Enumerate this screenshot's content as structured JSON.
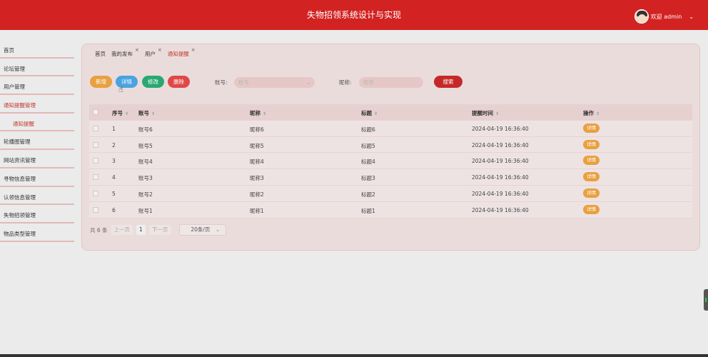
{
  "header": {
    "title": "失物招领系统设计与实现",
    "user": "欢迎 admin",
    "dropdown_icon": "chevron-down-icon"
  },
  "sidebar": {
    "items": [
      {
        "label": "首页"
      },
      {
        "label": "论坛管理"
      },
      {
        "label": "用户管理"
      },
      {
        "label": "通知提醒管理"
      },
      {
        "label": "通知提醒"
      },
      {
        "label": "轮播图管理"
      },
      {
        "label": "网站资讯管理"
      },
      {
        "label": "寻物信息管理"
      },
      {
        "label": "认领信息管理"
      },
      {
        "label": "失物招领管理"
      },
      {
        "label": "物品类型管理"
      }
    ]
  },
  "tabs": [
    {
      "label": "首页",
      "close": ""
    },
    {
      "label": "我的发布",
      "close": "×"
    },
    {
      "label": "用户",
      "close": "×"
    },
    {
      "label": "通知提醒",
      "close": "×"
    }
  ],
  "toolbar": {
    "add": "新增",
    "detail": "详情",
    "edit": "修改",
    "delete": "删除",
    "search": "搜索"
  },
  "filters": {
    "account_label": "账号:",
    "account_placeholder": "账号",
    "nickname_label": "昵称:",
    "nickname_placeholder": "昵称"
  },
  "table": {
    "columns": [
      "序号",
      "账号",
      "昵称",
      "标题",
      "提醒时间",
      "操作"
    ],
    "rows": [
      {
        "index": "1",
        "account": "账号6",
        "nickname": "昵称6",
        "title": "标题6",
        "time": "2024-04-19 16:36:40",
        "action": "详情"
      },
      {
        "index": "2",
        "account": "账号5",
        "nickname": "昵称5",
        "title": "标题5",
        "time": "2024-04-19 16:36:40",
        "action": "详情"
      },
      {
        "index": "3",
        "account": "账号4",
        "nickname": "昵称4",
        "title": "标题4",
        "time": "2024-04-19 16:36:40",
        "action": "详情"
      },
      {
        "index": "4",
        "account": "账号3",
        "nickname": "昵称3",
        "title": "标题3",
        "time": "2024-04-19 16:36:40",
        "action": "详情"
      },
      {
        "index": "5",
        "account": "账号2",
        "nickname": "昵称2",
        "title": "标题2",
        "time": "2024-04-19 16:36:40",
        "action": "详情"
      },
      {
        "index": "6",
        "account": "账号1",
        "nickname": "昵称1",
        "title": "标题1",
        "time": "2024-04-19 16:36:40",
        "action": "详情"
      }
    ]
  },
  "pagination": {
    "total": "共 6 条",
    "prev": "上一页",
    "page": "1",
    "next": "下一页",
    "page_size": "20条/页"
  },
  "colors": {
    "header": "#d32222",
    "accent": "#c0392b",
    "add": "#e8a040",
    "detail": "#4aa3e0",
    "edit": "#2aa873",
    "delete": "#e04848"
  }
}
